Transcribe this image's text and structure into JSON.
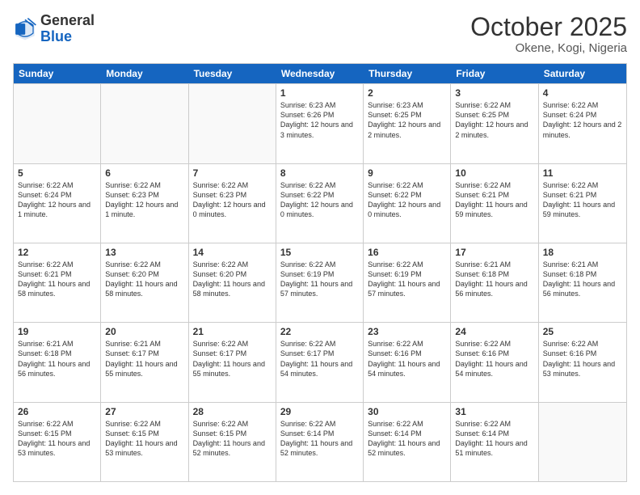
{
  "header": {
    "logo_general": "General",
    "logo_blue": "Blue",
    "month": "October 2025",
    "location": "Okene, Kogi, Nigeria"
  },
  "days": [
    "Sunday",
    "Monday",
    "Tuesday",
    "Wednesday",
    "Thursday",
    "Friday",
    "Saturday"
  ],
  "rows": [
    [
      {
        "day": "",
        "text": ""
      },
      {
        "day": "",
        "text": ""
      },
      {
        "day": "",
        "text": ""
      },
      {
        "day": "1",
        "text": "Sunrise: 6:23 AM\nSunset: 6:26 PM\nDaylight: 12 hours and 3 minutes."
      },
      {
        "day": "2",
        "text": "Sunrise: 6:23 AM\nSunset: 6:25 PM\nDaylight: 12 hours and 2 minutes."
      },
      {
        "day": "3",
        "text": "Sunrise: 6:22 AM\nSunset: 6:25 PM\nDaylight: 12 hours and 2 minutes."
      },
      {
        "day": "4",
        "text": "Sunrise: 6:22 AM\nSunset: 6:24 PM\nDaylight: 12 hours and 2 minutes."
      }
    ],
    [
      {
        "day": "5",
        "text": "Sunrise: 6:22 AM\nSunset: 6:24 PM\nDaylight: 12 hours and 1 minute."
      },
      {
        "day": "6",
        "text": "Sunrise: 6:22 AM\nSunset: 6:23 PM\nDaylight: 12 hours and 1 minute."
      },
      {
        "day": "7",
        "text": "Sunrise: 6:22 AM\nSunset: 6:23 PM\nDaylight: 12 hours and 0 minutes."
      },
      {
        "day": "8",
        "text": "Sunrise: 6:22 AM\nSunset: 6:22 PM\nDaylight: 12 hours and 0 minutes."
      },
      {
        "day": "9",
        "text": "Sunrise: 6:22 AM\nSunset: 6:22 PM\nDaylight: 12 hours and 0 minutes."
      },
      {
        "day": "10",
        "text": "Sunrise: 6:22 AM\nSunset: 6:21 PM\nDaylight: 11 hours and 59 minutes."
      },
      {
        "day": "11",
        "text": "Sunrise: 6:22 AM\nSunset: 6:21 PM\nDaylight: 11 hours and 59 minutes."
      }
    ],
    [
      {
        "day": "12",
        "text": "Sunrise: 6:22 AM\nSunset: 6:21 PM\nDaylight: 11 hours and 58 minutes."
      },
      {
        "day": "13",
        "text": "Sunrise: 6:22 AM\nSunset: 6:20 PM\nDaylight: 11 hours and 58 minutes."
      },
      {
        "day": "14",
        "text": "Sunrise: 6:22 AM\nSunset: 6:20 PM\nDaylight: 11 hours and 58 minutes."
      },
      {
        "day": "15",
        "text": "Sunrise: 6:22 AM\nSunset: 6:19 PM\nDaylight: 11 hours and 57 minutes."
      },
      {
        "day": "16",
        "text": "Sunrise: 6:22 AM\nSunset: 6:19 PM\nDaylight: 11 hours and 57 minutes."
      },
      {
        "day": "17",
        "text": "Sunrise: 6:21 AM\nSunset: 6:18 PM\nDaylight: 11 hours and 56 minutes."
      },
      {
        "day": "18",
        "text": "Sunrise: 6:21 AM\nSunset: 6:18 PM\nDaylight: 11 hours and 56 minutes."
      }
    ],
    [
      {
        "day": "19",
        "text": "Sunrise: 6:21 AM\nSunset: 6:18 PM\nDaylight: 11 hours and 56 minutes."
      },
      {
        "day": "20",
        "text": "Sunrise: 6:21 AM\nSunset: 6:17 PM\nDaylight: 11 hours and 55 minutes."
      },
      {
        "day": "21",
        "text": "Sunrise: 6:22 AM\nSunset: 6:17 PM\nDaylight: 11 hours and 55 minutes."
      },
      {
        "day": "22",
        "text": "Sunrise: 6:22 AM\nSunset: 6:17 PM\nDaylight: 11 hours and 54 minutes."
      },
      {
        "day": "23",
        "text": "Sunrise: 6:22 AM\nSunset: 6:16 PM\nDaylight: 11 hours and 54 minutes."
      },
      {
        "day": "24",
        "text": "Sunrise: 6:22 AM\nSunset: 6:16 PM\nDaylight: 11 hours and 54 minutes."
      },
      {
        "day": "25",
        "text": "Sunrise: 6:22 AM\nSunset: 6:16 PM\nDaylight: 11 hours and 53 minutes."
      }
    ],
    [
      {
        "day": "26",
        "text": "Sunrise: 6:22 AM\nSunset: 6:15 PM\nDaylight: 11 hours and 53 minutes."
      },
      {
        "day": "27",
        "text": "Sunrise: 6:22 AM\nSunset: 6:15 PM\nDaylight: 11 hours and 53 minutes."
      },
      {
        "day": "28",
        "text": "Sunrise: 6:22 AM\nSunset: 6:15 PM\nDaylight: 11 hours and 52 minutes."
      },
      {
        "day": "29",
        "text": "Sunrise: 6:22 AM\nSunset: 6:14 PM\nDaylight: 11 hours and 52 minutes."
      },
      {
        "day": "30",
        "text": "Sunrise: 6:22 AM\nSunset: 6:14 PM\nDaylight: 11 hours and 52 minutes."
      },
      {
        "day": "31",
        "text": "Sunrise: 6:22 AM\nSunset: 6:14 PM\nDaylight: 11 hours and 51 minutes."
      },
      {
        "day": "",
        "text": ""
      }
    ]
  ]
}
